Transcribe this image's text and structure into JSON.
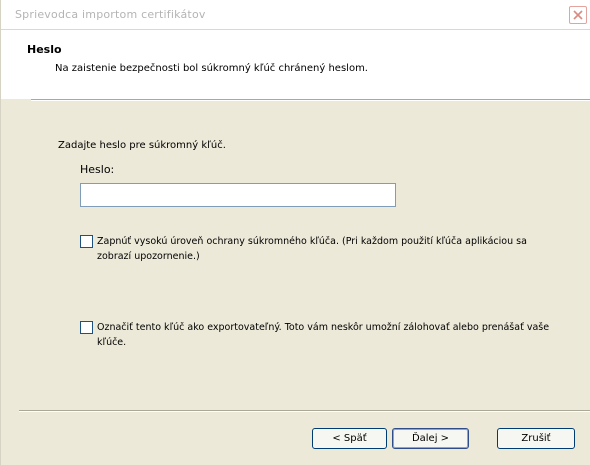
{
  "window": {
    "title": "Sprievodca importom certifikátov"
  },
  "header": {
    "title": "Heslo",
    "subtitle": "Na zaistenie bezpečnosti bol súkromný kľúč chránený heslom."
  },
  "form": {
    "prompt": "Zadajte heslo pre súkromný kľúč.",
    "password_label": "Heslo:",
    "password_value": ""
  },
  "options": [
    {
      "checked": false,
      "label": "Zapnúť vysokú úroveň ochrany súkromného kľúča. (Pri každom použití kľúča aplikáciou sa zobrazí upozornenie.)"
    },
    {
      "checked": false,
      "label": "Označiť tento kľúč ako exportovateľný. Toto vám neskôr umožní zálohovať alebo prenášať vaše kľúče."
    }
  ],
  "buttons": {
    "back": "< Späť",
    "next": "Ďalej >",
    "cancel": "Zrušiť"
  },
  "colors": {
    "dialog_bg": "#ece9d8",
    "header_bg": "#ffffff",
    "input_border": "#7f9db9",
    "checkbox_border": "#1c5180",
    "button_border": "#003c74"
  }
}
